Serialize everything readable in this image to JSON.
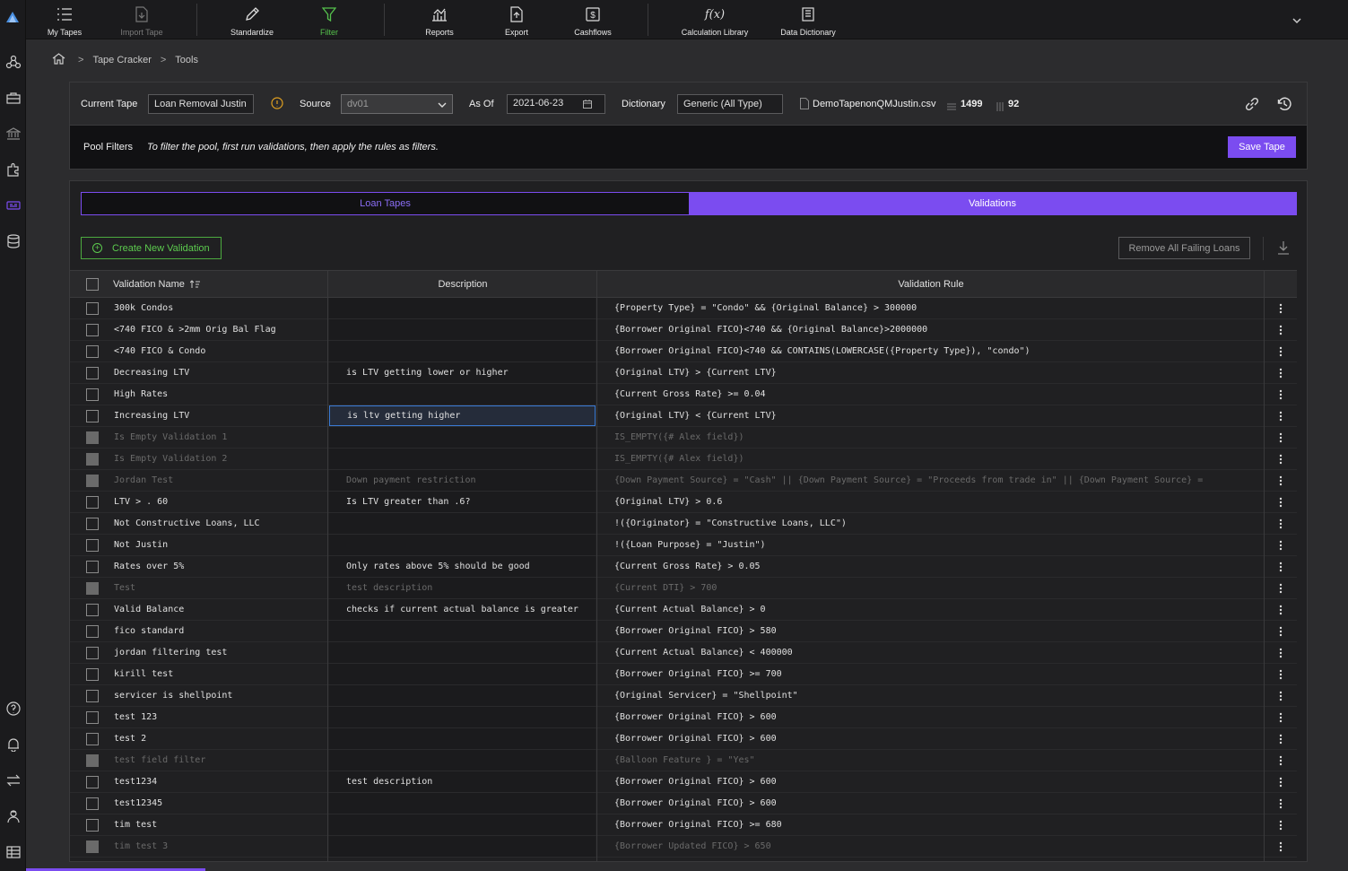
{
  "nav": {
    "items": [
      {
        "label": "My Tapes",
        "icon": "list-icon"
      },
      {
        "label": "Import Tape",
        "icon": "import-icon"
      },
      {
        "label": "Standardize",
        "icon": "pencil-icon"
      },
      {
        "label": "Filter",
        "icon": "filter-icon"
      },
      {
        "label": "Reports",
        "icon": "chart-icon"
      },
      {
        "label": "Export",
        "icon": "export-icon"
      },
      {
        "label": "Cashflows",
        "icon": "dollar-icon"
      },
      {
        "label": "Calculation Library",
        "icon": "function-icon"
      },
      {
        "label": "Data Dictionary",
        "icon": "book-icon"
      }
    ]
  },
  "breadcrumb": {
    "sep": ">",
    "tape_cracker": "Tape Cracker",
    "tools": "Tools"
  },
  "tape": {
    "current_label": "Current Tape",
    "current_value": "Loan Removal Justin",
    "source_label": "Source",
    "source_value": "dv01",
    "asof_label": "As Of",
    "asof_value": "2021-06-23",
    "dictionary_label": "Dictionary",
    "dictionary_value": "Generic (All Type)",
    "file_name": "DemoTapenonQMJustin.csv",
    "rows": "1499",
    "cols": "92"
  },
  "pool": {
    "label": "Pool Filters",
    "hint": "To filter the pool, first run validations, then apply the rules as filters.",
    "save": "Save Tape"
  },
  "tabs": {
    "loan_tapes": "Loan Tapes",
    "validations": "Validations"
  },
  "actions": {
    "create": "Create New Validation",
    "remove": "Remove All Failing Loans"
  },
  "table": {
    "headers": {
      "name": "Validation Name",
      "description": "Description",
      "rule": "Validation Rule"
    },
    "rows": [
      {
        "name": "300k Condos",
        "desc": "",
        "rule": "{Property Type} = \"Condo\" && {Original Balance} > 300000",
        "dim": false
      },
      {
        "name": "<740 FICO & >2mm Orig Bal Flag",
        "desc": "",
        "rule": "{Borrower Original FICO}<740 && {Original Balance}>2000000",
        "dim": false
      },
      {
        "name": "<740 FICO & Condo",
        "desc": "",
        "rule": "{Borrower Original FICO}<740 && CONTAINS(LOWERCASE({Property Type}), \"condo\")",
        "dim": false
      },
      {
        "name": "Decreasing LTV",
        "desc": "is LTV getting lower or higher",
        "rule": "{Original LTV} > {Current LTV}",
        "dim": false
      },
      {
        "name": "High Rates",
        "desc": "",
        "rule": "{Current Gross Rate} >= 0.04",
        "dim": false
      },
      {
        "name": "Increasing LTV",
        "desc": "is ltv getting higher",
        "rule": "{Original LTV} < {Current LTV}",
        "dim": false
      },
      {
        "name": "Is Empty Validation 1",
        "desc": "",
        "rule": "IS_EMPTY({# Alex field})",
        "dim": true
      },
      {
        "name": "Is Empty Validation 2",
        "desc": "",
        "rule": "IS_EMPTY({# Alex field})",
        "dim": true
      },
      {
        "name": "Jordan Test",
        "desc": "Down payment restriction",
        "rule": "{Down Payment Source} = \"Cash\" || {Down Payment Source} = \"Proceeds from trade in\" || {Down Payment Source} =",
        "dim": true
      },
      {
        "name": "LTV > . 60",
        "desc": "Is LTV greater than .6?",
        "rule": "{Original LTV} > 0.6",
        "dim": false
      },
      {
        "name": "Not Constructive Loans, LLC",
        "desc": "",
        "rule": "!({Originator} = \"Constructive Loans, LLC\")",
        "dim": false
      },
      {
        "name": "Not Justin",
        "desc": "",
        "rule": "!({Loan Purpose} = \"Justin\")",
        "dim": false
      },
      {
        "name": "Rates over 5%",
        "desc": "Only rates above 5% should be good",
        "rule": "{Current Gross Rate} > 0.05",
        "dim": false
      },
      {
        "name": "Test",
        "desc": "test description",
        "rule": "{Current DTI} > 700",
        "dim": true
      },
      {
        "name": "Valid Balance",
        "desc": "checks if current actual balance is greater",
        "rule": "{Current Actual Balance} > 0",
        "dim": false
      },
      {
        "name": "fico standard",
        "desc": "",
        "rule": "{Borrower Original FICO} > 580",
        "dim": false
      },
      {
        "name": "jordan filtering test",
        "desc": "",
        "rule": "{Current Actual Balance} < 400000",
        "dim": false
      },
      {
        "name": "kirill test",
        "desc": "",
        "rule": "{Borrower Original FICO} >= 700",
        "dim": false
      },
      {
        "name": "servicer is shellpoint",
        "desc": "",
        "rule": "{Original Servicer} = \"Shellpoint\"",
        "dim": false
      },
      {
        "name": "test 123",
        "desc": "",
        "rule": "{Borrower Original FICO} > 600",
        "dim": false
      },
      {
        "name": "test 2",
        "desc": "",
        "rule": "{Borrower Original FICO} > 600",
        "dim": false
      },
      {
        "name": "test field filter",
        "desc": "",
        "rule": "{Balloon Feature } = \"Yes\"",
        "dim": true
      },
      {
        "name": "test1234",
        "desc": "test description",
        "rule": "{Borrower Original FICO} > 600",
        "dim": false
      },
      {
        "name": "test12345",
        "desc": "",
        "rule": "{Borrower Original FICO} > 600",
        "dim": false
      },
      {
        "name": "tim test",
        "desc": "",
        "rule": "{Borrower Original FICO} >= 680",
        "dim": false
      },
      {
        "name": "tim test 3",
        "desc": "",
        "rule": "{Borrower Updated FICO} > 650",
        "dim": true
      }
    ]
  }
}
